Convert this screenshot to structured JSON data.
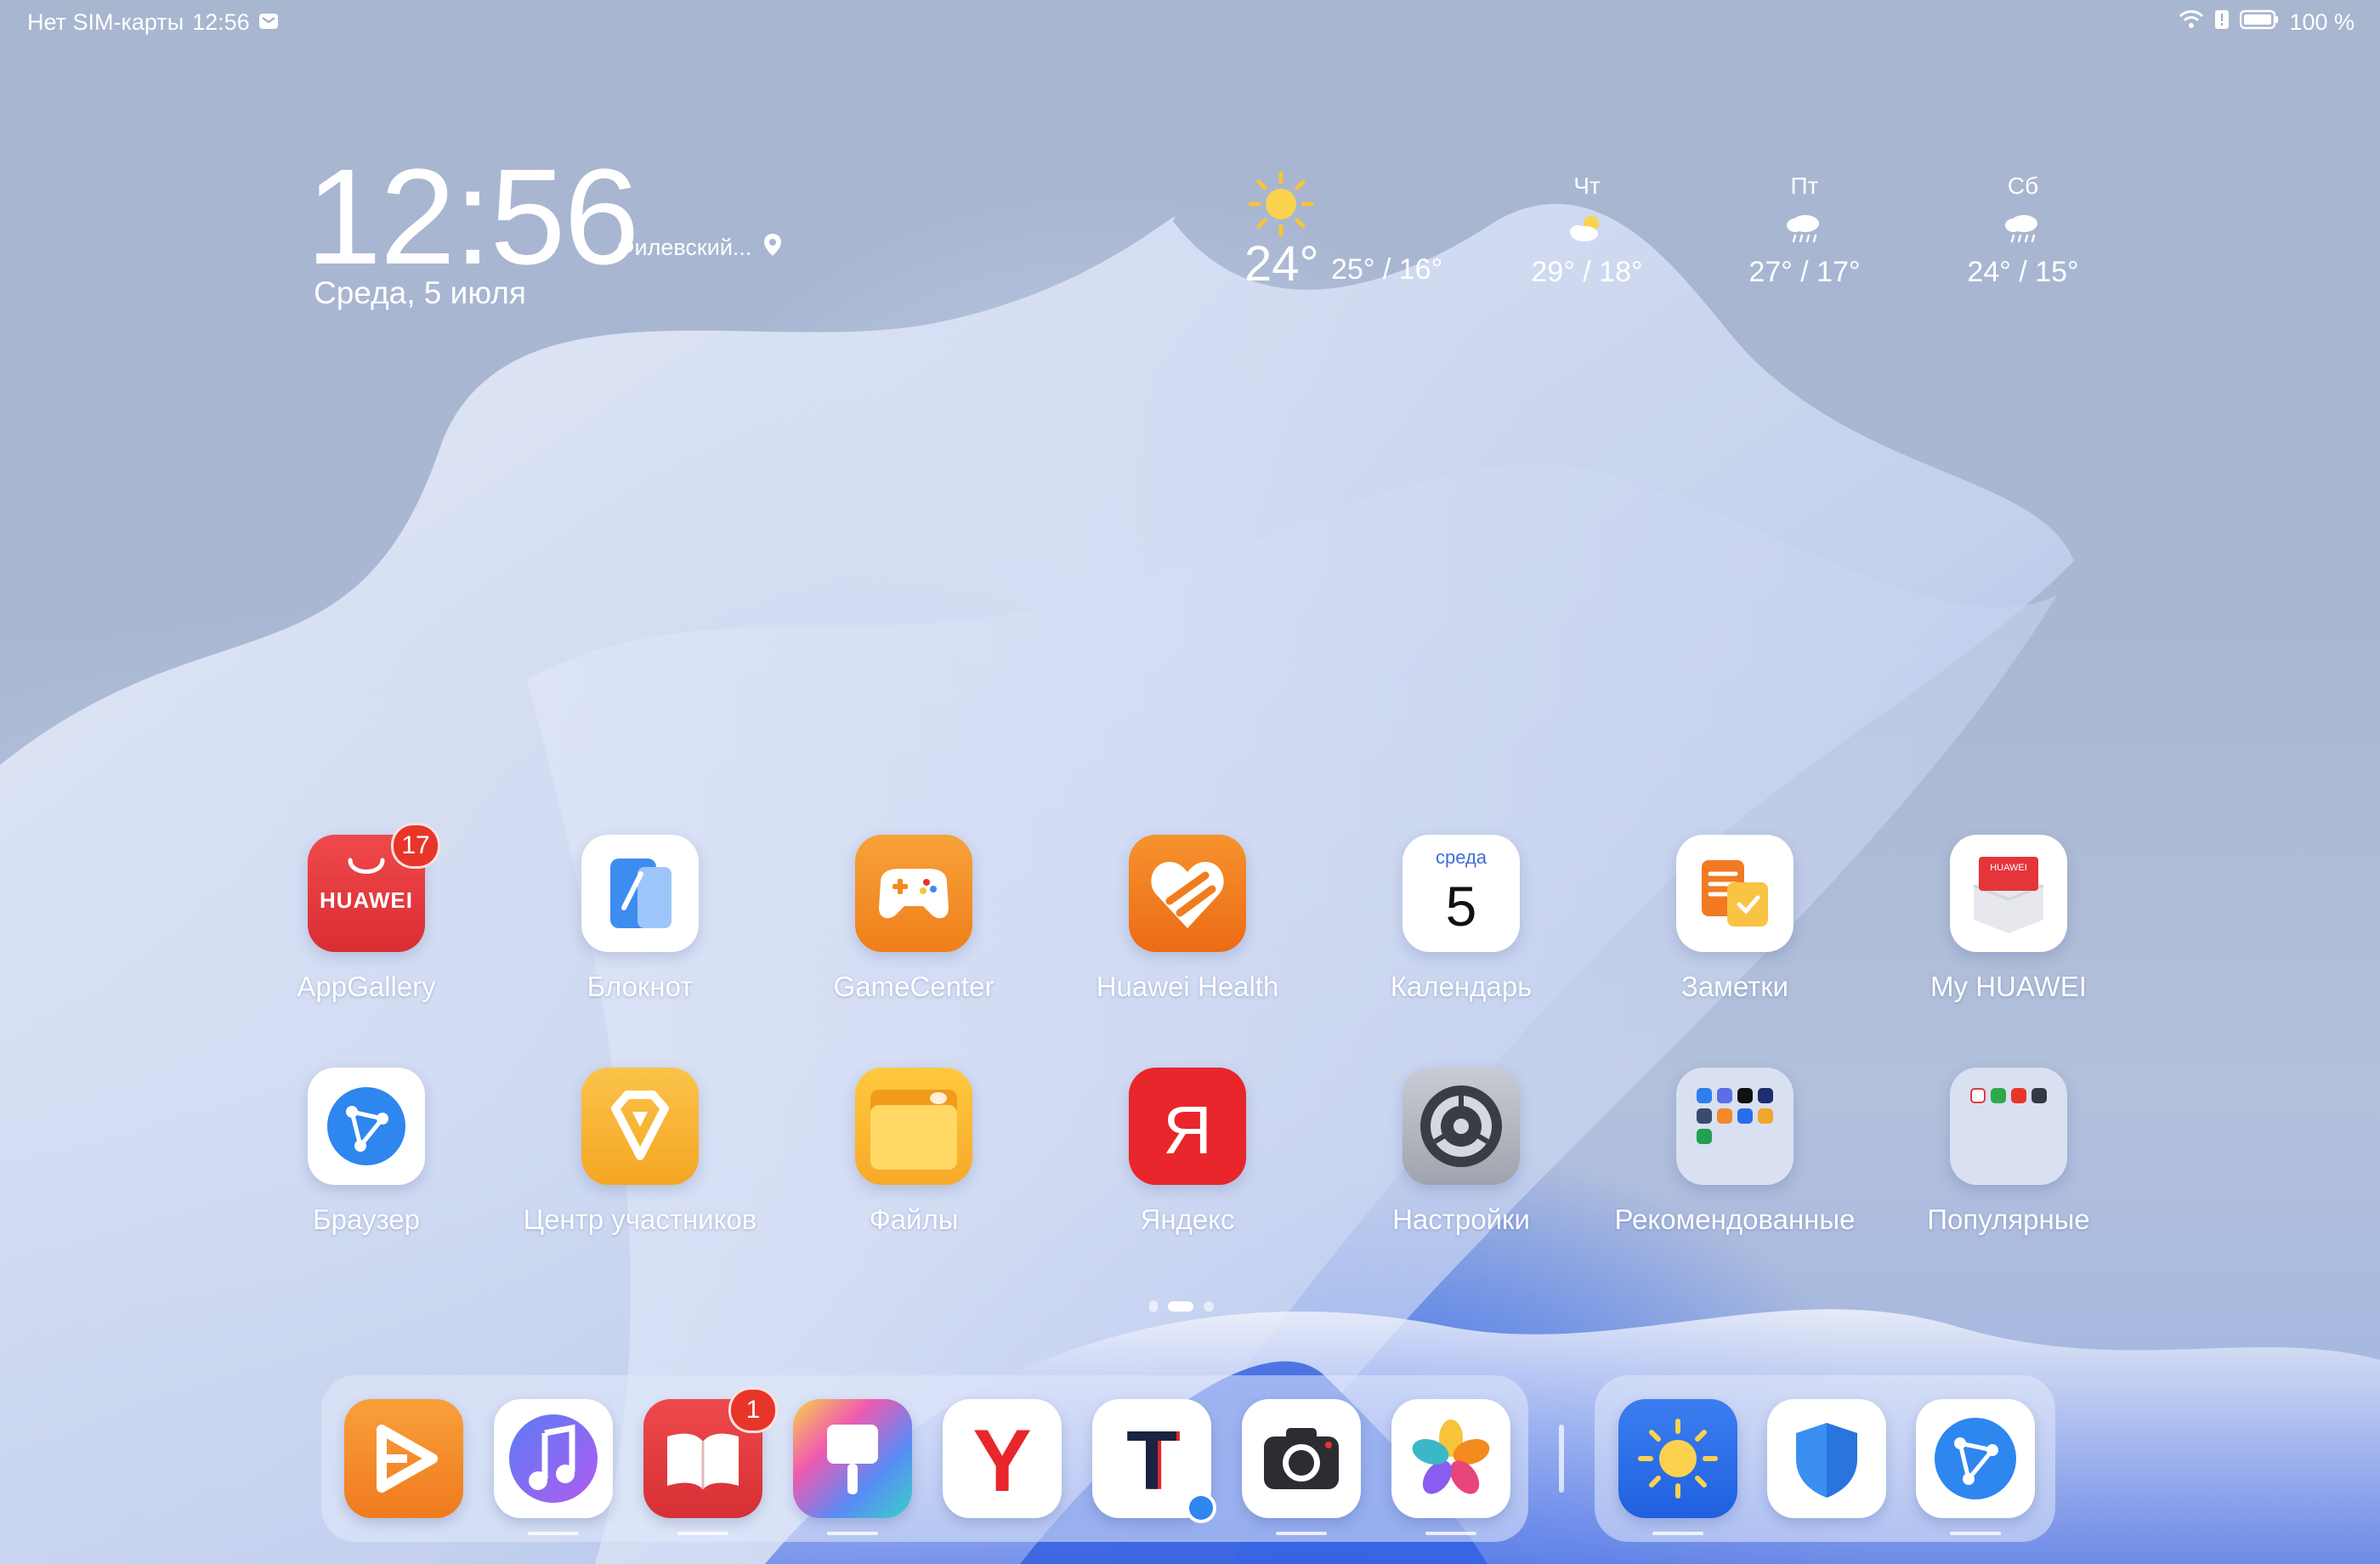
{
  "status_bar": {
    "sim": "Нет SIM-карты",
    "time": "12:56",
    "battery": "100 %"
  },
  "clock_widget": {
    "time": "12:56",
    "location": "Филевский...",
    "date": "Среда, 5 июля"
  },
  "weather": {
    "current_temp": "24°",
    "current_range": "25° / 16°",
    "forecast": [
      {
        "day": "Чт",
        "range": "29° / 18°",
        "icon": "partly-cloudy-icon"
      },
      {
        "day": "Пт",
        "range": "27° / 17°",
        "icon": "rain-icon"
      },
      {
        "day": "Сб",
        "range": "24° / 15°",
        "icon": "rain-icon"
      }
    ]
  },
  "apps_row1": [
    {
      "label": "AppGallery",
      "badge": "17",
      "brand": "HUAWEI"
    },
    {
      "label": "Блокнот"
    },
    {
      "label": "GameCenter"
    },
    {
      "label": "Huawei Health"
    },
    {
      "label": "Календарь",
      "cal_day_name": "среда",
      "cal_day_num": "5"
    },
    {
      "label": "Заметки"
    },
    {
      "label": "My HUAWEI",
      "brand": "HUAWEI"
    }
  ],
  "apps_row2": [
    {
      "label": "Браузер"
    },
    {
      "label": "Центр участников"
    },
    {
      "label": "Файлы"
    },
    {
      "label": "Яндекс",
      "glyph": "Я"
    },
    {
      "label": "Настройки"
    },
    {
      "label": "Рекомендованные"
    },
    {
      "label": "Популярные"
    }
  ],
  "dock": {
    "apps": [
      {
        "icon": "video-icon"
      },
      {
        "icon": "music-icon"
      },
      {
        "icon": "books-icon",
        "badge": "1"
      },
      {
        "icon": "themes-icon"
      },
      {
        "icon": "yandex-browser-icon",
        "glyph": "Y"
      },
      {
        "icon": "t-app-icon",
        "glyph": "T"
      },
      {
        "icon": "camera-icon"
      },
      {
        "icon": "gallery-icon"
      }
    ],
    "recent": [
      {
        "icon": "weather-icon"
      },
      {
        "icon": "security-shield-icon"
      },
      {
        "icon": "browser-icon"
      }
    ]
  },
  "colors": {
    "badge": "#e8352a",
    "appgallery": "#e8373d",
    "gamecenter": "#f28a1e",
    "health": "#f07c1f",
    "yandex": "#e8262b"
  }
}
